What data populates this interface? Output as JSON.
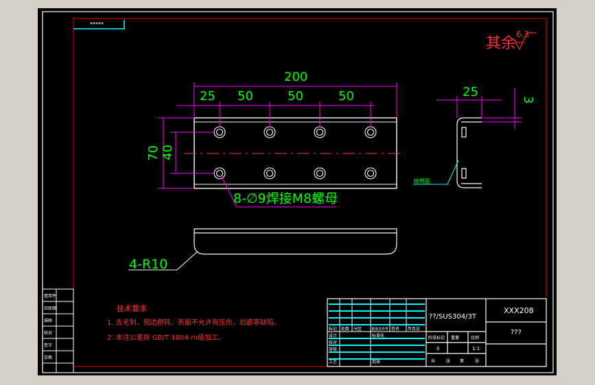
{
  "drawing": {
    "top_tag": "*****",
    "roughness": {
      "label": "其余",
      "value": "6.3"
    },
    "dims": {
      "overall": "200",
      "seg1": "25",
      "seg2": "50",
      "seg3": "50",
      "seg4": "50",
      "h_outer": "70",
      "h_inner": "40",
      "side_w": "25",
      "side_t": "3"
    },
    "hole_callout": "8-∅9焊接M8螺母",
    "radius_callout": "4-R10",
    "side_note": "接地面"
  },
  "tech_req": {
    "title": "技术要求",
    "items": [
      "1. 去毛刺，锐边倒钝，表面不允许有压伤、划痕等缺陷。",
      "2. 未注公差按 GB/T 1804-m级加工。"
    ]
  },
  "title_block": {
    "material": "??/SUS304/3T",
    "drawing_no": "XXX208",
    "part_name": "???",
    "row_labels": [
      "标记",
      "处数",
      "分区",
      "更改文件号",
      "签名",
      "年月日"
    ],
    "designer_row": [
      "设计",
      "标准化"
    ],
    "sub_labels": [
      "校对",
      "审核",
      "工艺",
      "批准"
    ],
    "stage_labels": [
      "阶段标记",
      "重量",
      "比例"
    ],
    "scale": "1:1",
    "weight": "0",
    "sheet_labels": [
      "共",
      "张",
      "第",
      "张"
    ]
  },
  "left_strip": [
    "借用件",
    "旧底图",
    "描图",
    "校对",
    "签字",
    "日期"
  ]
}
